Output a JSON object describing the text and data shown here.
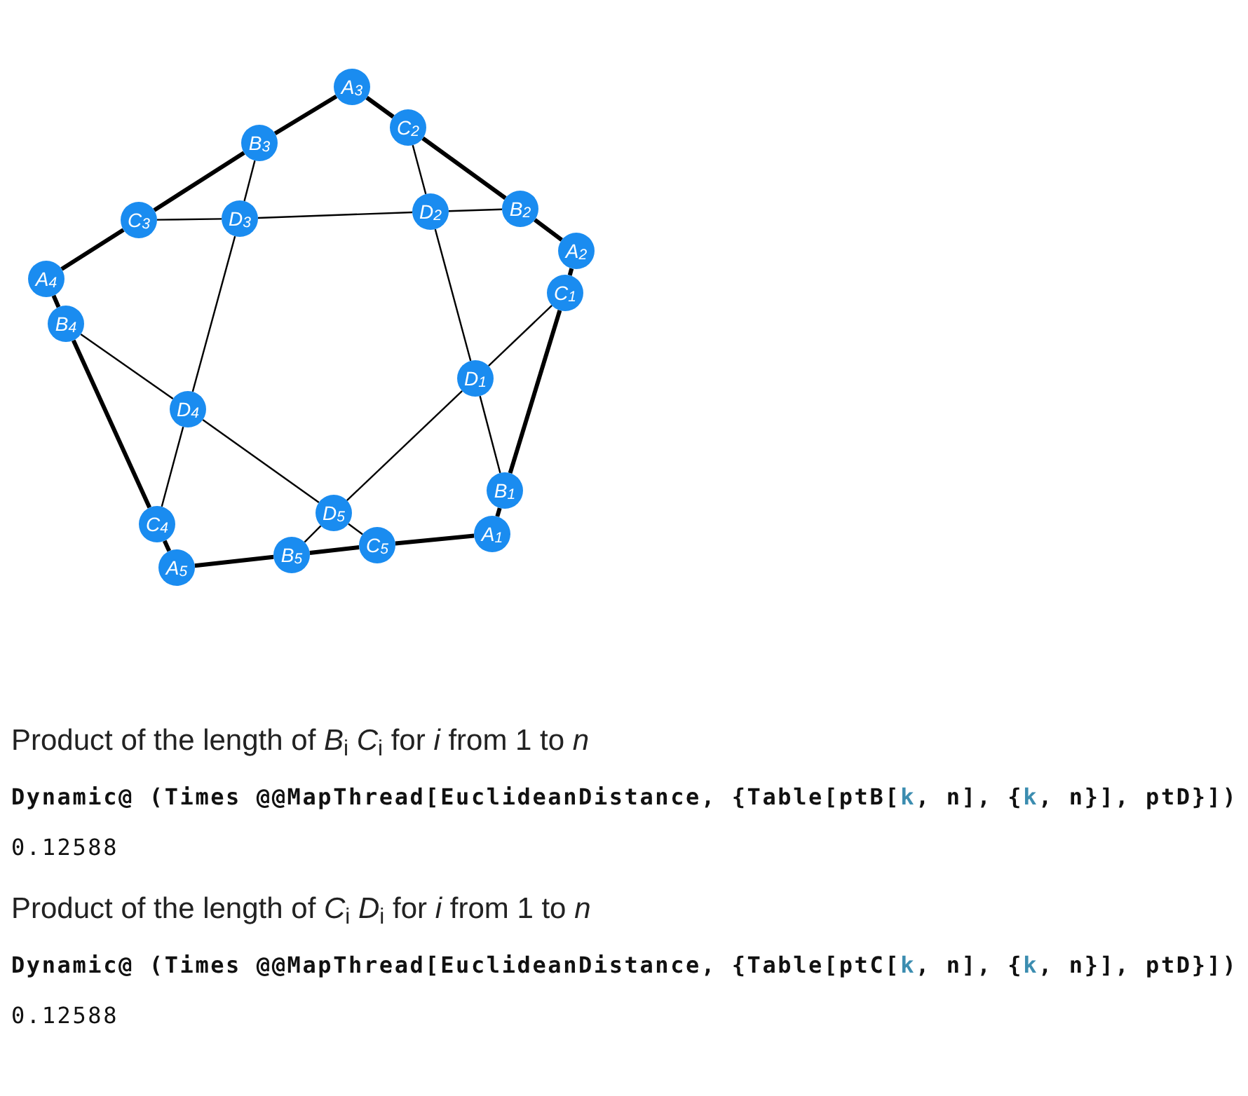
{
  "graph": {
    "nodes": [
      "A$_{3}$",
      "C$_{2}$",
      "B$_{3}$",
      "C$_{3}$",
      "D$_{3}$",
      "D$_{2}$",
      "B$_{2}$",
      "A$_{2}$",
      "C$_{1}$",
      "A$_{4}$",
      "B$_{4}$",
      "D$_{1}$",
      "D$_{4}$",
      "B$_{1}$",
      "D$_{5}$",
      "C$_{4}$",
      "A$_{1}$",
      "C$_{5}$",
      "B$_{5}$",
      "A$_{5}$"
    ]
  },
  "cells": [
    {
      "kind": "text",
      "text": "Product of the length of *B*$_{i}$ *C*$_{i}$ for *i* from 1 to *n*"
    },
    {
      "kind": "input",
      "tokens": [
        {
          "kind": "plain",
          "text": "Dynamic@ (Times @@MapThread[EuclideanDistance, {Table[ptB["
        },
        {
          "kind": "var",
          "text": "k"
        },
        {
          "kind": "plain",
          "text": ", n], {"
        },
        {
          "kind": "var",
          "text": "k"
        },
        {
          "kind": "plain",
          "text": ", n}], ptD}])"
        }
      ]
    },
    {
      "kind": "output",
      "text": "0.12588"
    },
    {
      "kind": "text",
      "text": "Product of the length of *C*$_{i}$ *D*$_{i}$ for *i* from 1 to *n*"
    },
    {
      "kind": "input",
      "tokens": [
        {
          "kind": "plain",
          "text": "Dynamic@ (Times @@MapThread[EuclideanDistance, {Table[ptC["
        },
        {
          "kind": "var",
          "text": "k"
        },
        {
          "kind": "plain",
          "text": ", n], {"
        },
        {
          "kind": "var",
          "text": "k"
        },
        {
          "kind": "plain",
          "text": ", n}], ptD}])"
        }
      ]
    },
    {
      "kind": "output",
      "text": "0.12588"
    }
  ]
}
